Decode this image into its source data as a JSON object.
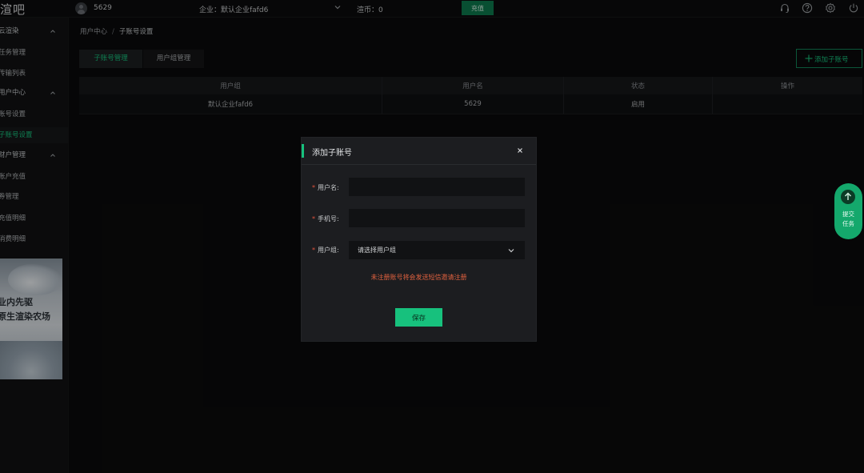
{
  "app": {
    "logo": "渲吧"
  },
  "header": {
    "user_id": "5629",
    "company": "企业：默认企业fafd6",
    "coins": "渲币：0",
    "recharge_label": "充值"
  },
  "sidebar": {
    "items": [
      {
        "label": "云渲染",
        "type": "group",
        "expanded": true
      },
      {
        "label": "任务管理",
        "type": "item"
      },
      {
        "label": "传输列表",
        "type": "item"
      },
      {
        "label": "用户中心",
        "type": "group",
        "expanded": true
      },
      {
        "label": "账号设置",
        "type": "item"
      },
      {
        "label": "子账号设置",
        "type": "item",
        "active": true
      },
      {
        "label": "财户管理",
        "type": "group",
        "expanded": true
      },
      {
        "label": "账户充值",
        "type": "item"
      },
      {
        "label": "券管理",
        "type": "item"
      },
      {
        "label": "充值明细",
        "type": "item"
      },
      {
        "label": "消费明细",
        "type": "item"
      }
    ],
    "banner": {
      "line1": "业内先驱",
      "line2": "原生渲染农场"
    }
  },
  "breadcrumb": {
    "parent": "用户中心",
    "separator": "/",
    "current": "子账号设置"
  },
  "tabs": [
    {
      "label": "子账号管理",
      "active": true
    },
    {
      "label": "用户组管理",
      "active": false
    }
  ],
  "add_button_label": "添加子账号",
  "table": {
    "headers": [
      "用户组",
      "用户名",
      "状态",
      "操作"
    ],
    "rows": [
      [
        "默认企业fafd6",
        "5629",
        "启用",
        ""
      ]
    ]
  },
  "modal": {
    "title": "添加子账号",
    "required_mark": "*",
    "fields": {
      "username_label": "用户名:",
      "username_value": "",
      "phone_label": "手机号:",
      "phone_value": "",
      "group_label": "用户组:",
      "group_placeholder": "请选择用户组"
    },
    "hint": "未注册账号将会发送短信邀请注册",
    "save_label": "保存"
  },
  "float_task": {
    "line1": "提交",
    "line2": "任务"
  },
  "colors": {
    "accent": "#17c17d",
    "warning": "#e3623f",
    "background": "#0a0a0b"
  }
}
